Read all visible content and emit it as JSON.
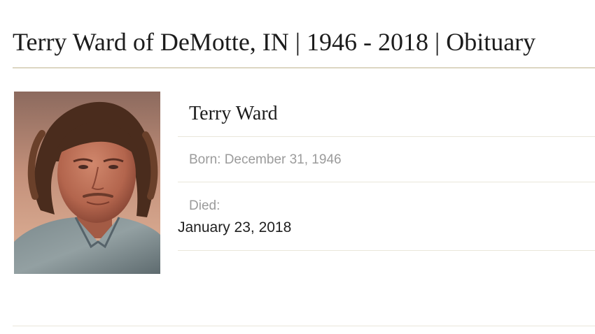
{
  "page": {
    "title": "Terry Ward of DeMotte, IN | 1946 - 2018 | Obituary"
  },
  "person": {
    "name": "Terry Ward",
    "born_text": "Born: December 31, 1946",
    "died_label": "Died:",
    "died_date": "January 23, 2018"
  },
  "colors": {
    "title_rule": "#ddd6c2",
    "divider": "#e9e6da",
    "muted_text": "#9b9b9b"
  }
}
